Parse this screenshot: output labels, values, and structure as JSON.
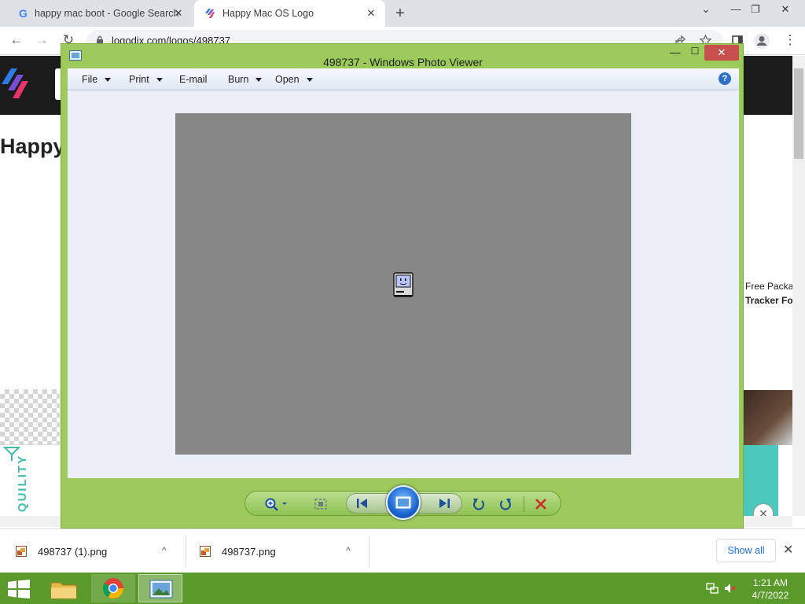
{
  "browser": {
    "tabs": [
      {
        "title": "happy mac boot - Google Search",
        "close": "✕"
      },
      {
        "title": "Happy Mac OS Logo",
        "close": "✕"
      }
    ],
    "new_tab": "+",
    "window_controls": {
      "dropdown": "⌄",
      "minimize": "—",
      "restore": "❐",
      "close": "✕"
    },
    "nav": {
      "back": "←",
      "forward": "→",
      "reload": "↻",
      "menu": "⋮"
    },
    "url": "logodix.com/logos/498737"
  },
  "webpage": {
    "title": "Happy",
    "promo_line1": "Free Packa",
    "promo_line2": "Tracker Fo",
    "ad_text": "QUILITY",
    "ad_close": "✕"
  },
  "photo_viewer": {
    "title": "498737 - Windows Photo Viewer",
    "minimize": "—",
    "maximize": "☐",
    "close": "✕",
    "menu": [
      "File",
      "Print",
      "E-mail",
      "Burn",
      "Open"
    ],
    "help": "?",
    "accent": "#9ccb5b"
  },
  "downloads": {
    "items": [
      {
        "name": "498737 (1).png",
        "caret": "^"
      },
      {
        "name": "498737.png",
        "caret": "^"
      }
    ],
    "show_all": "Show all",
    "close": "✕"
  },
  "taskbar": {
    "time": "1:21 AM",
    "date": "4/7/2022"
  }
}
